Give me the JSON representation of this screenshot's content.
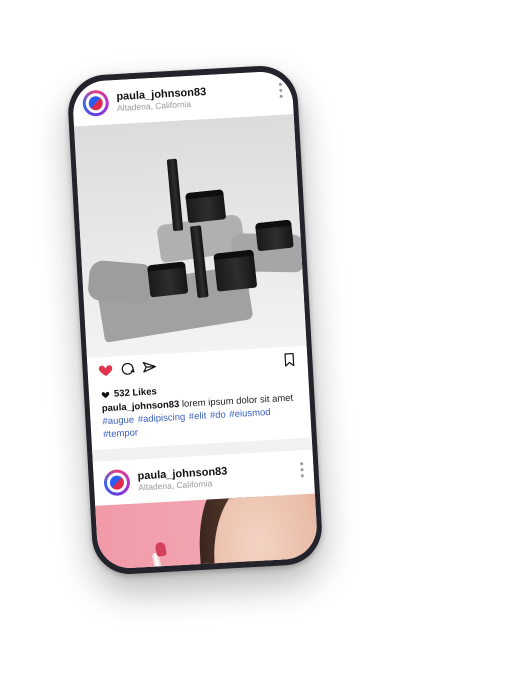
{
  "posts": [
    {
      "username": "paula_johnson83",
      "location": "Altadena, California"
    },
    {
      "username": "paula_johnson83",
      "location": "Altadena, California"
    }
  ],
  "feed": {
    "likes": "532 Likes",
    "caption_user": "paula_johnson83",
    "caption_text": " lorem ipsum dolor sit amet",
    "hashtags": "#augue  #adipiscing #elit #do #eiusmod #tempor"
  },
  "icons": {
    "like": "heart-icon",
    "comment": "comment-icon",
    "share": "send-icon",
    "save": "bookmark-icon",
    "more": "more-vertical-icon"
  },
  "colors": {
    "like": "#e0334d",
    "hashtag": "#3a5fc0",
    "phone_frame": "#23232b"
  }
}
